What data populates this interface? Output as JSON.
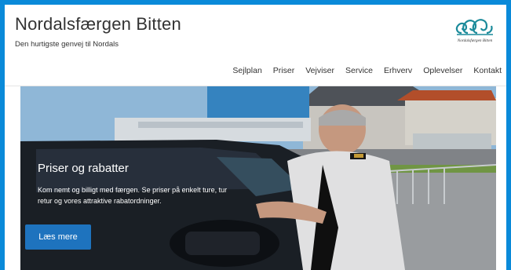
{
  "site": {
    "title": "Nordalsfærgen Bitten",
    "tagline": "Den hurtigste genvej til Nordals",
    "logo_text": "Nordalsfærgen Bitten",
    "logo_icon": "wave-logo-icon"
  },
  "nav": {
    "items": [
      {
        "label": "Sejlplan"
      },
      {
        "label": "Priser"
      },
      {
        "label": "Vejviser"
      },
      {
        "label": "Service"
      },
      {
        "label": "Erhverv"
      },
      {
        "label": "Oplevelser"
      },
      {
        "label": "Kontakt"
      }
    ]
  },
  "hero": {
    "title": "Priser og rabatter",
    "text": "Kom nemt og billigt med færgen. Se priser på enkelt ture, tur retur og vores attraktive rabatordninger.",
    "button_label": "Læs mere"
  },
  "colors": {
    "frame_border": "#0a8ad9",
    "button": "#1e73be",
    "logo_teal": "#1a8a9a"
  }
}
